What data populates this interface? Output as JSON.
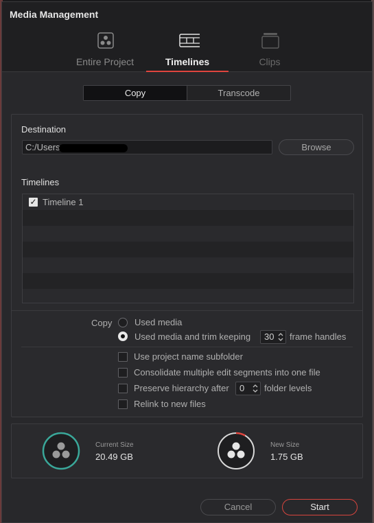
{
  "window": {
    "title": "Media Management"
  },
  "tabs": [
    {
      "label": "Entire Project",
      "icon": "resolve-logo-icon",
      "state": "inactive"
    },
    {
      "label": "Timelines",
      "icon": "timeline-film-icon",
      "state": "active"
    },
    {
      "label": "Clips",
      "icon": "clips-stack-icon",
      "state": "disabled"
    }
  ],
  "mode": {
    "copy_label": "Copy",
    "transcode_label": "Transcode",
    "selected": "Copy"
  },
  "destination": {
    "label": "Destination",
    "path_value": "C:/Users",
    "browse_label": "Browse"
  },
  "timelines": {
    "label": "Timelines",
    "items": [
      {
        "name": "Timeline 1",
        "checked": true
      }
    ]
  },
  "copy_options": {
    "label": "Copy",
    "used_media_label": "Used media",
    "trim_label": "Used media and trim keeping",
    "frame_handles_value": "30",
    "frame_handles_suffix": "frame handles",
    "selected": "trim"
  },
  "checkboxes": {
    "subfolder": "Use project name subfolder",
    "consolidate": "Consolidate multiple edit segments into one file",
    "preserve_prefix": "Preserve hierarchy after",
    "preserve_value": "0",
    "preserve_suffix": "folder levels",
    "relink": "Relink to new files"
  },
  "sizes": {
    "current_label": "Current Size",
    "current_value": "20.49 GB",
    "new_label": "New Size",
    "new_value": "1.75 GB",
    "new_fraction": 0.085
  },
  "footer": {
    "cancel_label": "Cancel",
    "start_label": "Start"
  },
  "colors": {
    "accent": "#e0453e",
    "current_ring": "#3aa89a",
    "new_ring": "#d9d9d9"
  }
}
